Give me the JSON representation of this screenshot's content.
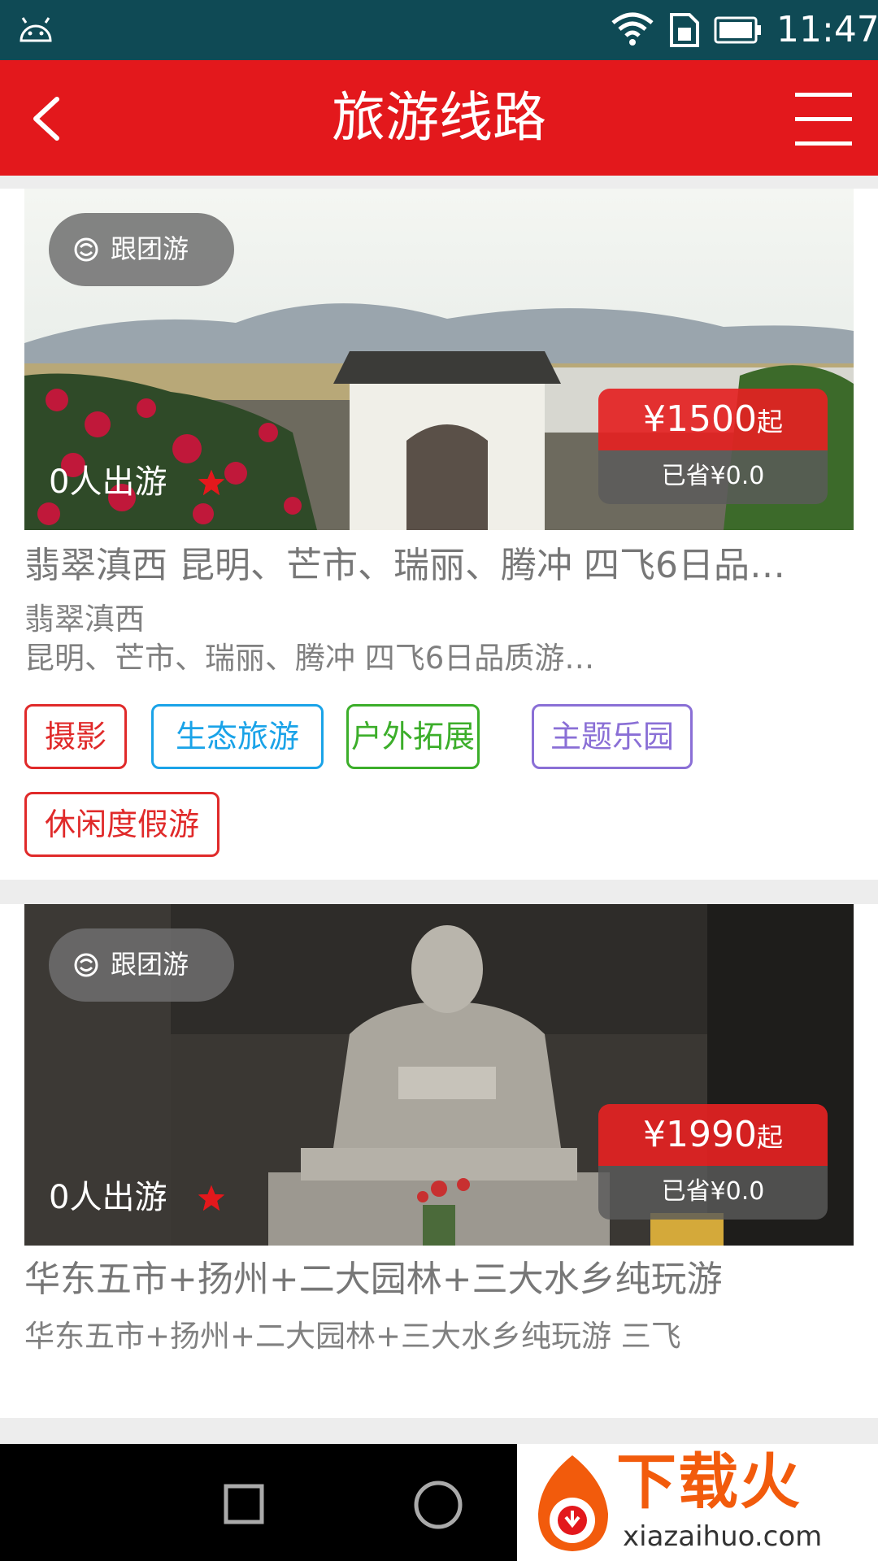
{
  "status_bar": {
    "time": "11:47"
  },
  "app_bar": {
    "title": "旅游线路"
  },
  "tours": [
    {
      "tour_type": "跟团游",
      "travelers": "0人出游",
      "rating_stars": 5,
      "price": "¥1500",
      "price_suffix": "起",
      "saved": "已省¥0.0",
      "headline": "翡翠滇西 昆明、芒市、瑞丽、腾冲 四飞6日品…",
      "desc_line1": "翡翠滇西",
      "desc_line2": "昆明、芒市、瑞丽、腾冲 四飞6日品质游…",
      "tags": [
        {
          "label": "摄影",
          "color": "#e02a2a"
        },
        {
          "label": "生态旅游",
          "color": "#1aa3e8"
        },
        {
          "label": "户外拓展",
          "color": "#3cae2a"
        },
        {
          "label": "主题乐园",
          "color": "#8a6fd6"
        },
        {
          "label": "休闲度假游",
          "color": "#e02a2a"
        }
      ]
    },
    {
      "tour_type": "跟团游",
      "travelers": "0人出游",
      "rating_stars": 5,
      "price": "¥1990",
      "price_suffix": "起",
      "saved": "已省¥0.0",
      "headline": "华东五市+扬州+二大园林+三大水乡纯玩游",
      "desc_line1": "华东五市+扬州+二大园林+三大水乡纯玩游 三飞"
    }
  ],
  "watermark": {
    "brand": "下载火",
    "url": "xiazaihuo.com"
  },
  "colors": {
    "primary": "#e3181c",
    "statusbar": "#0f4a55",
    "star": "#e3181c"
  },
  "icons": [
    "android-icon",
    "wifi-icon",
    "sim-icon",
    "battery-icon",
    "back-arrow-icon",
    "menu-icon",
    "tour-group-icon",
    "star-icon",
    "recent-apps-icon",
    "home-icon"
  ]
}
